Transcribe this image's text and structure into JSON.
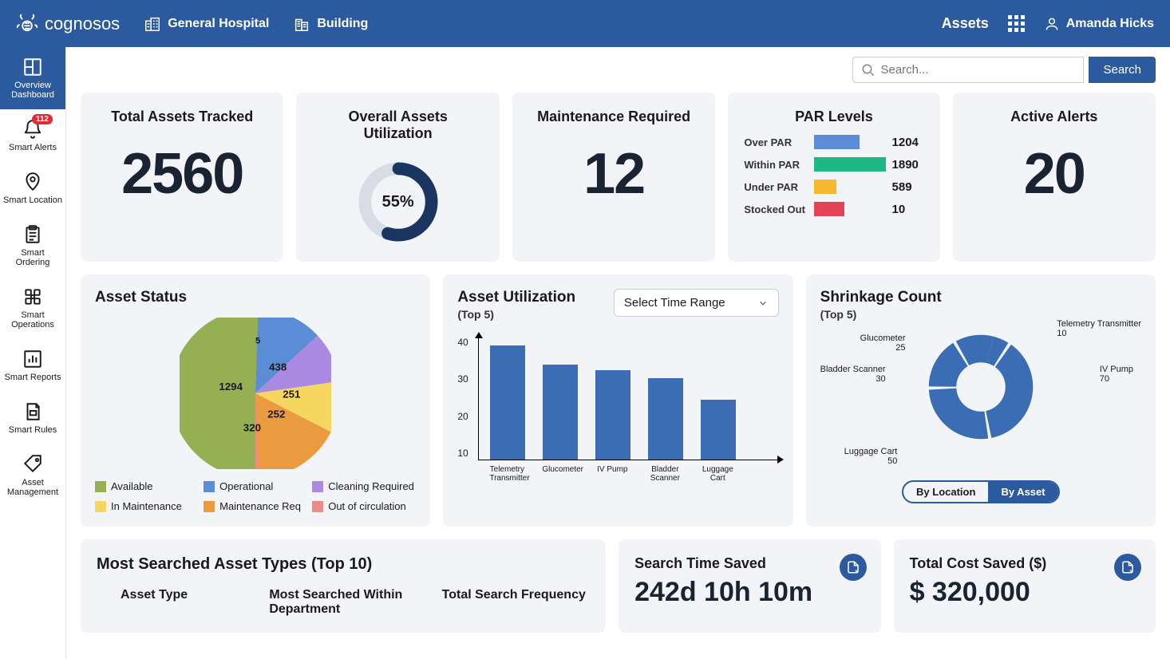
{
  "brand": "cognosos",
  "context": {
    "location": "General Hospital",
    "building": "Building"
  },
  "topnav": {
    "assets": "Assets",
    "user": "Amanda Hicks"
  },
  "search": {
    "placeholder": "Search...",
    "button": "Search"
  },
  "sidebar": {
    "items": [
      {
        "label": "Overview Dashboard"
      },
      {
        "label": "Smart Alerts",
        "badge": "112"
      },
      {
        "label": "Smart Location"
      },
      {
        "label": "Smart Ordering"
      },
      {
        "label": "Smart Operations"
      },
      {
        "label": "Smart Reports"
      },
      {
        "label": "Smart Rules"
      },
      {
        "label": "Asset Management"
      }
    ]
  },
  "kpi": {
    "total_tracked": {
      "title": "Total Assets Tracked",
      "value": "2560"
    },
    "utilization": {
      "title": "Overall Assets Utilization",
      "value": "55%"
    },
    "maintenance": {
      "title": "Maintenance Required",
      "value": "12"
    },
    "par": {
      "title": "PAR Levels",
      "rows": [
        {
          "label": "Over PAR",
          "value": "1204",
          "color": "#5a8dd6",
          "pct": 64
        },
        {
          "label": "Within PAR",
          "value": "1890",
          "color": "#1db883",
          "pct": 100
        },
        {
          "label": "Under PAR",
          "value": "589",
          "color": "#f5b82e",
          "pct": 31
        },
        {
          "label": "Stocked Out",
          "value": "10",
          "color": "#e34455",
          "pct": 42
        }
      ]
    },
    "alerts": {
      "title": "Active Alerts",
      "value": "20"
    }
  },
  "asset_status": {
    "title": "Asset Status",
    "legend": [
      {
        "label": "Available",
        "color": "#94b052"
      },
      {
        "label": "Operational",
        "color": "#5a8dd6"
      },
      {
        "label": "Cleaning Required",
        "color": "#a98ae0"
      },
      {
        "label": "In Maintenance",
        "color": "#f5d75f"
      },
      {
        "label": "Maintenance Req",
        "color": "#ec9a3f"
      },
      {
        "label": "Out of circulation",
        "color": "#ed8b8b"
      }
    ]
  },
  "chart_data": [
    {
      "name": "asset_status",
      "type": "pie",
      "title": "Asset Status",
      "series": [
        {
          "name": "Available",
          "value": 1294,
          "color": "#94b052"
        },
        {
          "name": "Operational",
          "value": 320,
          "color": "#5a8dd6"
        },
        {
          "name": "Cleaning Required",
          "value": 252,
          "color": "#a98ae0"
        },
        {
          "name": "In Maintenance",
          "value": 251,
          "color": "#f5d75f"
        },
        {
          "name": "Maintenance Req",
          "value": 438,
          "color": "#ec9a3f"
        },
        {
          "name": "Out of circulation",
          "value": 5,
          "color": "#ed8b8b"
        }
      ]
    },
    {
      "name": "asset_utilization",
      "type": "bar",
      "title": "Asset Utilization (Top 5)",
      "categories": [
        "Telemetry Transmitter",
        "Glucometer",
        "IV Pump",
        "Bladder Scanner",
        "Luggage Cart"
      ],
      "values": [
        42,
        35,
        33,
        30,
        22
      ],
      "ylabel": "",
      "ylim": [
        0,
        45
      ],
      "yticks": [
        10,
        20,
        30,
        40
      ]
    },
    {
      "name": "shrinkage_count",
      "type": "pie",
      "title": "Shrinkage Count (Top 5)",
      "series": [
        {
          "name": "Telemetry Transmitter",
          "value": 10
        },
        {
          "name": "IV Pump",
          "value": 70
        },
        {
          "name": "Luggage Cart",
          "value": 50
        },
        {
          "name": "Bladder Scanner",
          "value": 30
        },
        {
          "name": "Glucometer",
          "value": 25
        }
      ]
    },
    {
      "name": "par_levels",
      "type": "bar",
      "title": "PAR Levels",
      "categories": [
        "Over PAR",
        "Within PAR",
        "Under PAR",
        "Stocked Out"
      ],
      "values": [
        1204,
        1890,
        589,
        10
      ]
    }
  ],
  "asset_util": {
    "title": "Asset Utilization",
    "sub": "(Top 5)",
    "select": "Select Time Range",
    "yticks": [
      "40",
      "30",
      "20",
      "10"
    ],
    "bars": [
      {
        "label": "Telemetry Transmitter",
        "h": 42
      },
      {
        "label": "Glucometer",
        "h": 35
      },
      {
        "label": "IV Pump",
        "h": 33
      },
      {
        "label": "Bladder Scanner",
        "h": 30
      },
      {
        "label": "Luggage Cart",
        "h": 22
      }
    ]
  },
  "shrinkage": {
    "title": "Shrinkage Count",
    "sub": "(Top 5)",
    "labels": [
      {
        "name": "Telemetry Transmitter",
        "val": "10"
      },
      {
        "name": "IV Pump",
        "val": "70"
      },
      {
        "name": "Luggage Cart",
        "val": "50"
      },
      {
        "name": "Bladder Scanner",
        "val": "30"
      },
      {
        "name": "Glucometer",
        "val": "25"
      }
    ],
    "toggle": {
      "a": "By Location",
      "b": "By Asset"
    }
  },
  "most_searched": {
    "title": "Most Searched Asset Types (Top 10)",
    "cols": [
      "Asset Type",
      "Most Searched Within Department",
      "Total Search Frequency"
    ]
  },
  "time_saved": {
    "title": "Search Time Saved",
    "value": "242d 10h 10m"
  },
  "cost_saved": {
    "title": "Total Cost Saved ($)",
    "value": "$ 320,000"
  }
}
